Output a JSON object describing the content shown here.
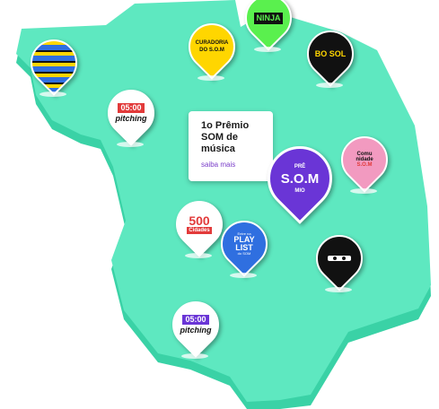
{
  "colors": {
    "map_top": "#5ee8c0",
    "map_side": "#3ad2a6",
    "purple": "#6a35d6",
    "red": "#e23a3a",
    "yellow": "#ffd600",
    "pink": "#f29ac0",
    "green": "#5af04e",
    "blue": "#2f6fe0"
  },
  "card": {
    "title": "1o Prêmio SOM de música",
    "link": "saiba mais"
  },
  "pins": {
    "ninja": {
      "text": "NINJA"
    },
    "curadoria": {
      "line1": "CURADORIA",
      "line2": "DO S.O.M"
    },
    "bom": {
      "text": "BO SOL"
    },
    "pitching_top": {
      "time": "05:00",
      "label": "pitching"
    },
    "comunidade": {
      "line1": "Comu",
      "line2": "nidade",
      "line3": "S.O.M"
    },
    "premio": {
      "top": "PRÊ",
      "main": "S.O.M",
      "bottom": "MIO"
    },
    "cidades": {
      "num": "500",
      "label": "Cidades"
    },
    "playlist": {
      "small": "Entre na",
      "line1": "PLAY",
      "line2": "LIST",
      "sub": "do SOM"
    },
    "pitching_bottom": {
      "time": "05:00",
      "label": "pitching"
    }
  }
}
